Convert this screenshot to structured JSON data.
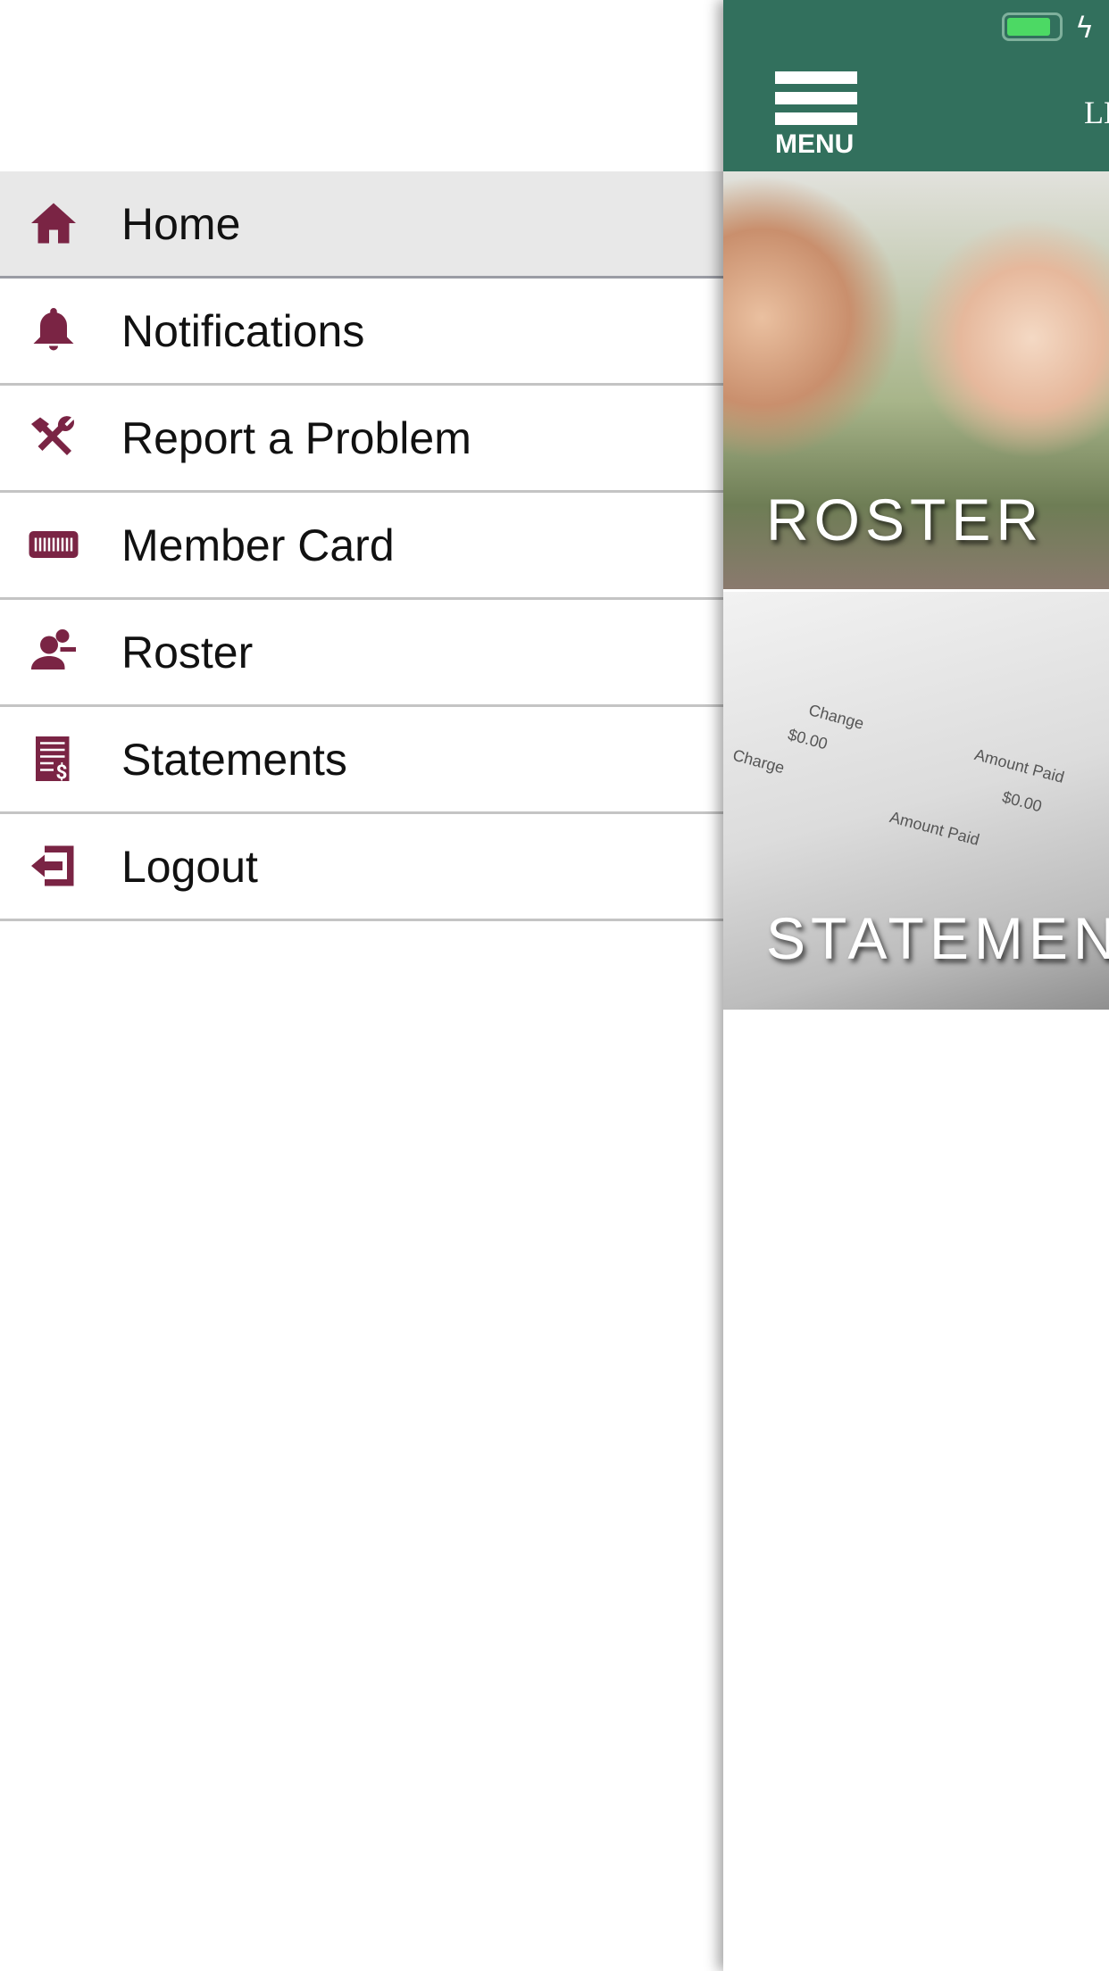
{
  "status_bar": {
    "battery_level": 0.85,
    "charging": true
  },
  "header": {
    "menu_label": "MENU",
    "title_partial": "LE",
    "color": "#32705d"
  },
  "drawer": {
    "accent": "#7a2444",
    "items": [
      {
        "label": "Home",
        "icon": "home-icon",
        "active": true
      },
      {
        "label": "Notifications",
        "icon": "bell-icon"
      },
      {
        "label": "Report a Problem",
        "icon": "tools-icon"
      },
      {
        "label": "Member Card",
        "icon": "barcode-card-icon"
      },
      {
        "label": "Roster",
        "icon": "roster-icon"
      },
      {
        "label": "Statements",
        "icon": "statement-icon"
      },
      {
        "label": "Logout",
        "icon": "logout-icon"
      }
    ]
  },
  "tiles": [
    {
      "caption": "ROSTER"
    },
    {
      "caption": "STATEMENTS",
      "image_text": [
        "Change",
        "$0.00",
        "Amount Paid",
        "$0.00",
        "Charge",
        "Amount Paid"
      ]
    }
  ]
}
